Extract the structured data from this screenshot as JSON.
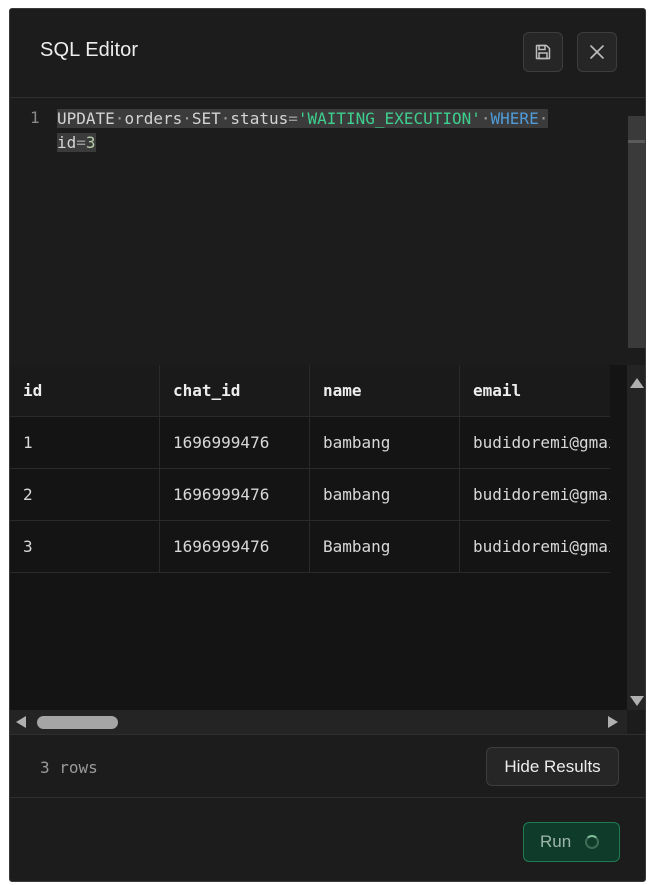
{
  "dialog": {
    "title": "SQL Editor",
    "save_icon": "save-icon",
    "close_icon": "close-icon"
  },
  "editor": {
    "line_number": "1",
    "query": "UPDATE orders SET status='WAITING_EXECUTION' WHERE id=3",
    "tokens": {
      "t1": "UPDATE",
      "t2": "orders",
      "t3": "SET",
      "t4": "status",
      "t5": "=",
      "t6": "'WAITING_EXECUTION'",
      "t7": "WHERE",
      "t8": "id",
      "t9": "=",
      "t10": "3"
    }
  },
  "results": {
    "columns": [
      "id",
      "chat_id",
      "name",
      "email"
    ],
    "rows": [
      [
        "1",
        "1696999476",
        "bambang",
        "budidoremi@gmail.com"
      ],
      [
        "2",
        "1696999476",
        "bambang",
        "budidoremi@gmail.com"
      ],
      [
        "3",
        "1696999476",
        "Bambang",
        "budidoremi@gmail.com"
      ]
    ]
  },
  "status": {
    "row_count": "3 rows",
    "hide_results_label": "Hide Results"
  },
  "footer": {
    "run_label": "Run",
    "run_state": "loading"
  },
  "colors": {
    "accent": "#3ecf8e",
    "keyword_blue": "#4f9bd9",
    "run_button_bg": "#0f3b2a"
  }
}
